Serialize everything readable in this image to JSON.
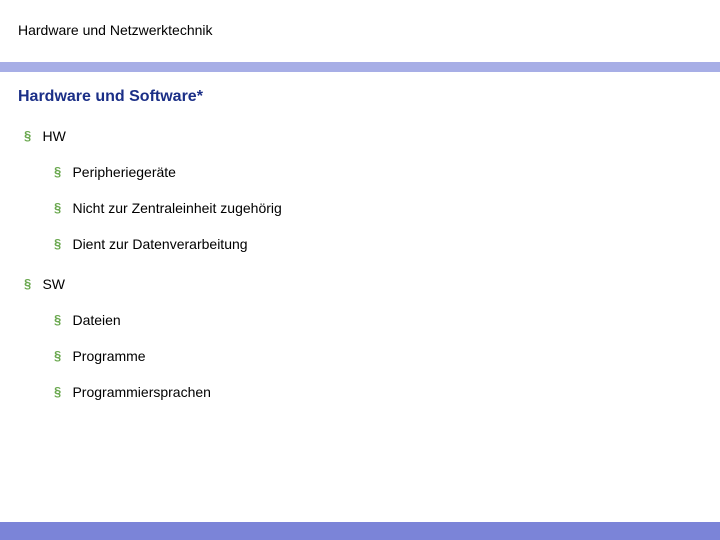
{
  "header": {
    "title": "Hardware und Netzwerktechnik"
  },
  "subtitle": "Hardware und Software*",
  "bullet_glyph": "§",
  "sections": [
    {
      "label": "HW",
      "items": [
        "Peripheriegeräte",
        "Nicht zur Zentraleinheit zugehörig",
        "Dient zur Datenverarbeitung"
      ]
    },
    {
      "label": "SW",
      "items": [
        "Dateien",
        "Programme",
        "Programmiersprachen"
      ]
    }
  ],
  "colors": {
    "accent_bar": "#a7aee6",
    "footer_bar": "#7b84d8",
    "bullet": "#6aa84f",
    "subtitle": "#1b2f87"
  }
}
